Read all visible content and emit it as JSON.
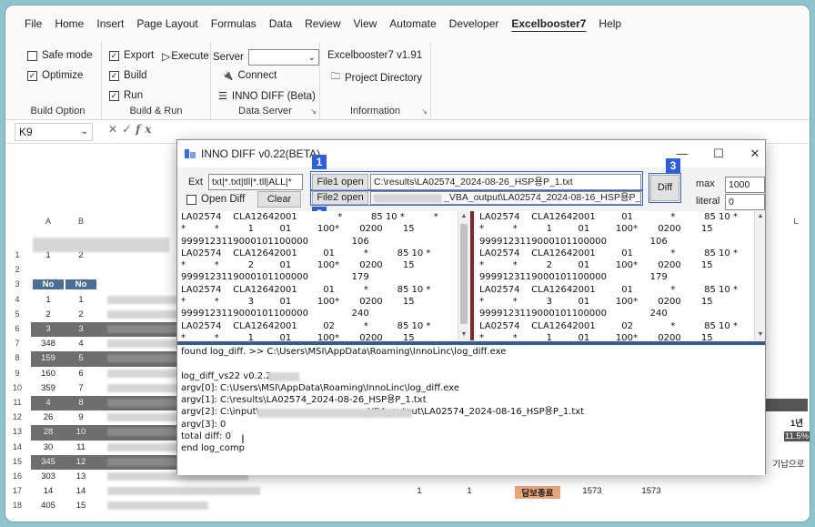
{
  "menu": [
    "File",
    "Home",
    "Insert",
    "Page Layout",
    "Formulas",
    "Data",
    "Review",
    "View",
    "Automate",
    "Developer",
    "Excelbooster7",
    "Help"
  ],
  "ribbon": {
    "build_option": {
      "safe_mode": "Safe mode",
      "optimize": "Optimize",
      "title": "Build Option"
    },
    "build_run": {
      "export": "Export",
      "execute": "Execute",
      "build": "Build",
      "run": "Run",
      "title": "Build & Run"
    },
    "data_server": {
      "server_label": "Server",
      "connect": "Connect",
      "inno_diff": "INNO DIFF (Beta)",
      "title": "Data Server"
    },
    "information": {
      "version": "Excelbooster7 v1.91",
      "project_directory": "Project Directory",
      "title": "Information"
    }
  },
  "formula_bar": {
    "name_box": "K9",
    "fx": "fx"
  },
  "sheet": {
    "col_headers": [
      "A",
      "B"
    ],
    "row_numbers": [
      "1",
      "2",
      "3",
      "4",
      "5",
      "6",
      "7",
      "8",
      "9",
      "10",
      "11",
      "12",
      "13",
      "14",
      "15",
      "16",
      "17",
      "18"
    ],
    "col_a": [
      "1",
      "",
      "No",
      "1",
      "2",
      "3",
      "348",
      "159",
      "160",
      "359",
      "4",
      "26",
      "28",
      "30",
      "345",
      "303",
      "14",
      "405"
    ],
    "col_b": [
      "2",
      "",
      "No",
      "1",
      "2",
      "3",
      "4",
      "5",
      "6",
      "7",
      "8",
      "9",
      "10",
      "11",
      "12",
      "13",
      "14",
      "15"
    ],
    "right_labels": {
      "l": "L",
      "year": "1년",
      "pct": "11.5%",
      "korean": "기납으로",
      "row17_label": "담보종료",
      "row17_v1": "1573",
      "row17_v2": "1573",
      "one_a": "1",
      "one_b": "1"
    }
  },
  "dialog": {
    "title": "INNO DIFF v0.22(BETA)",
    "ext_label": "Ext",
    "ext_value": "txt|*.txt|tll|*.tll|ALL|*",
    "open_diff": "Open Diff",
    "clear": "Clear",
    "file1_open": "File1 open",
    "file2_open": "File2 open",
    "file1_path": "C:\\results\\LA02574_2024-08-26_HSP용P_1.txt",
    "file2_path": "_VBA_output\\LA02574_2024-08-16_HSP용P_1.txt",
    "diff": "Diff",
    "max_label": "max",
    "max_value": "1000",
    "literal_label": "literal",
    "literal_value": "0",
    "badges": [
      "1",
      "2",
      "3",
      "4"
    ],
    "left_pane": [
      "LA02574    CLA12642001              *          85 10 *          *",
      "*          *          1         01         100*       0200       15",
      "9999123119000101100000               106",
      "LA02574    CLA12642001         01          *          85 10 *          *",
      "*          *          2         01         100*       0200       15",
      "9999123119000101100000               179",
      "LA02574    CLA12642001         01          *          85 10 *          *",
      "*          *          3         01         100*       0200       15",
      "9999123119000101100000               240",
      "LA02574    CLA12642001         02          *          85 10 *          *",
      "*          *          1         01         100*       0200       15"
    ],
    "right_pane": [
      "LA02574    CLA12642001         01             *          85 10 *",
      "*          *          1         01         100*       0200       15",
      "9999123119000101100000               106",
      "LA02574    CLA12642001         01             *          85 10 *",
      "*          *          2         01         100*       0200       15",
      "9999123119000101100000               179",
      "LA02574    CLA12642001         01             *          85 10 *",
      "*          *          3         01         100*       0200       15",
      "9999123119000101100000               240",
      "LA02574    CLA12642001         02             *          85 10 *",
      "*          *          1         01         100*       0200       15"
    ],
    "log": [
      "found log_diff. >> C:\\Users\\MSI\\AppData\\Roaming\\InnoLinc\\log_diff.exe",
      "",
      "log_diff_vs22 v0.2.2",
      "argv[0]: C:\\Users\\MSI\\AppData\\Roaming\\InnoLinc\\log_diff.exe",
      "argv[1]: C:\\results\\LA02574_2024-08-26_HSP용P_1.txt",
      "argv[2]: C:\\input\\                                    _VBA_output\\LA02574_2024-08-16_HSP용P_1.txt",
      "argv[3]: 0",
      "total diff: 0",
      "end log_comp"
    ]
  },
  "colors": {
    "accent_blue": "#2f5fd8",
    "dark_row": "#6e6e6e",
    "split_blue": "#3c5a8a",
    "split_red": "#7a2a2a"
  }
}
